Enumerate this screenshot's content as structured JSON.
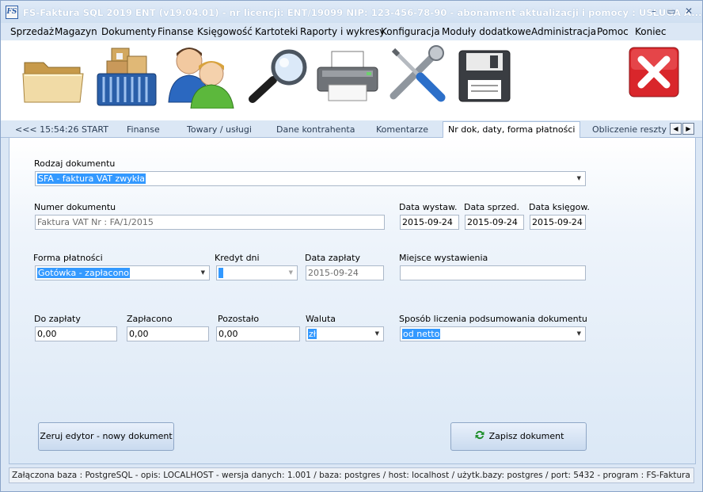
{
  "window": {
    "icon_text": "FS",
    "title": "FS-Faktura SQL 2019 ENT (v19.04.01)   -   nr licencji: ENT/19099    NIP: 123-456-78-90   -   abonament aktualizacji i pomocy : USŁUGA A...",
    "minimize_label": "–",
    "maximize_label": "▭",
    "close_label": "✕"
  },
  "menu": {
    "items": [
      "Sprzedaż",
      "Magazyn",
      "Dokumenty",
      "Finanse",
      "Księgowość",
      "Kartoteki",
      "Raporty i wykresy",
      "Konfiguracja",
      "Moduły dodatkowe",
      "Administracja",
      "Pomoc",
      "Koniec"
    ]
  },
  "toolbar": {
    "icons": [
      "folder-icon",
      "basket-icon",
      "contractors-icon",
      "search-icon",
      "printer-icon",
      "tools-icon",
      "save-icon",
      "close-red-icon"
    ]
  },
  "tabs": {
    "start": "<<<  15:54:26  START",
    "items": [
      "Finanse",
      "Towary  / usługi",
      "Dane kontrahenta",
      "Komentarze",
      "Nr dok, daty, forma płatności",
      "Obliczenie reszty"
    ],
    "active_index": 4,
    "prev_arrow": "◀",
    "next_arrow": "▶"
  },
  "form": {
    "rodzaj_label": "Rodzaj dokumentu",
    "rodzaj_value": "SFA - faktura VAT zwykła",
    "numer_label": "Numer dokumentu",
    "numer_value": "Faktura VAT Nr :  FA/1/2015",
    "data_wystaw_label": "Data wystaw.",
    "data_wystaw_value": "2015-09-24",
    "data_sprzed_label": "Data sprzed.",
    "data_sprzed_value": "2015-09-24",
    "data_ksieg_label": "Data księgow.",
    "data_ksieg_value": "2015-09-24",
    "forma_label": "Forma płatności",
    "forma_value": "Gotówka - zapłacono",
    "kredyt_label": "Kredyt dni",
    "kredyt_value": "",
    "data_zaplaty_label": "Data zapłaty",
    "data_zaplaty_value": "2015-09-24",
    "miejsce_label": "Miejsce wystawienia",
    "miejsce_value": "",
    "do_zaplaty_label": "Do zapłaty",
    "do_zaplaty_value": "0,00",
    "zaplacono_label": "Zapłacono",
    "zaplacono_value": "0,00",
    "pozostalo_label": "Pozostało",
    "pozostalo_value": "0,00",
    "waluta_label": "Waluta",
    "waluta_value": "zł",
    "sposob_label": "Sposób liczenia podsumowania dokumentu",
    "sposob_value": "od netto",
    "caret": "▼"
  },
  "buttons": {
    "reset_label": "Zeruj edytor  -  nowy dokument",
    "save_label": "Zapisz dokument"
  },
  "status": {
    "text": "Załączona baza : PostgreSQL - opis: LOCALHOST - wersja danych: 1.001  / baza: postgres / host: localhost / użytk.bazy: postgres /  port: 5432  -  program :  FS-Faktura SQL PRO"
  },
  "colors": {
    "selection": "#3399ff",
    "window_bg": "#dbe7f5",
    "close_red": "#d9262b"
  }
}
